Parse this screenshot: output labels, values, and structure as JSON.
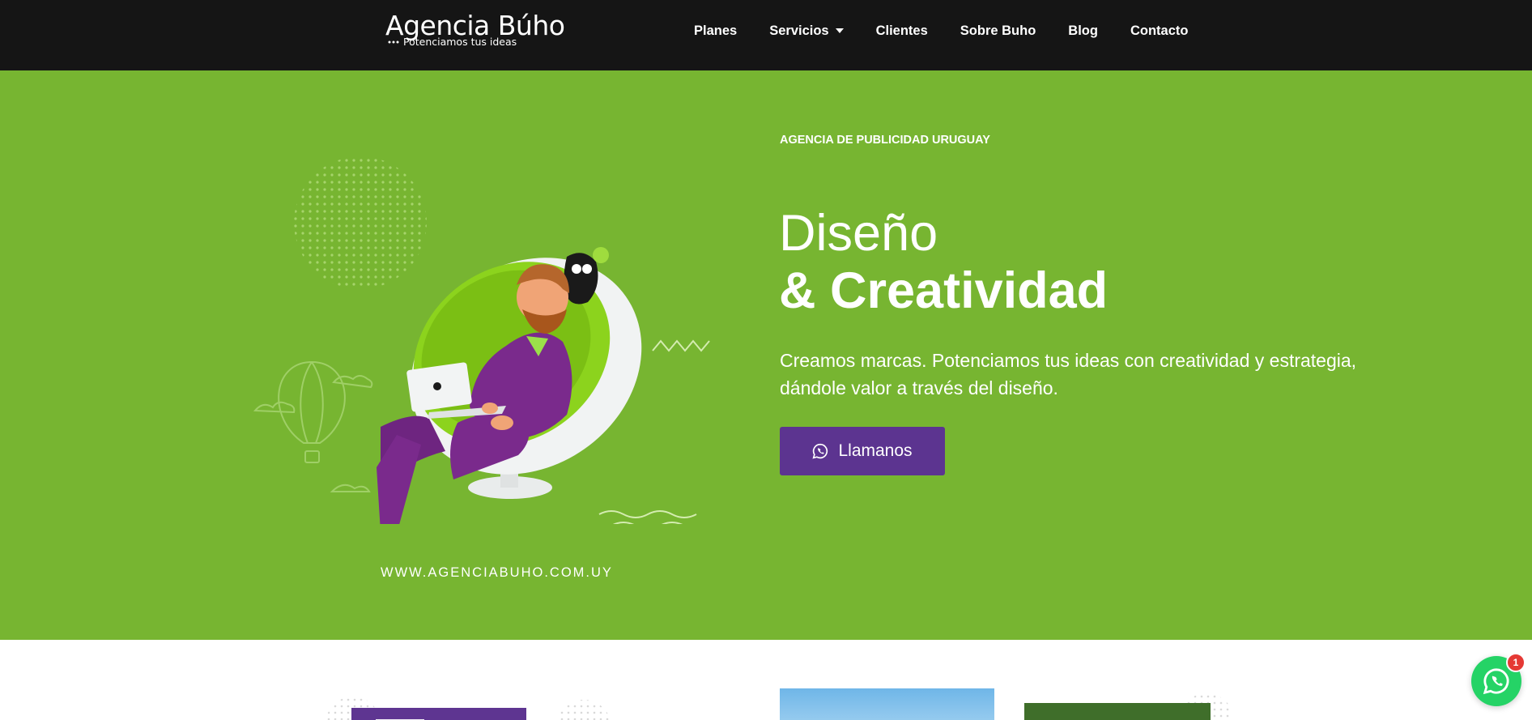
{
  "brand": {
    "name": "Agencia Búho",
    "tagline": "Potenciamos tus ideas"
  },
  "nav": {
    "items": [
      "Planes",
      "Servicios",
      "Clientes",
      "Sobre Buho",
      "Blog",
      "Contacto"
    ],
    "dropdown_item": "Servicios"
  },
  "hero": {
    "eyebrow": "AGENCIA DE PUBLICIDAD URUGUAY",
    "title_light": "Diseño",
    "title_bold": "& Creatividad",
    "description": "Creamos marcas. Potenciamos tus ideas con creatividad y estrategia, dándole valor a través del diseño.",
    "cta_label": "Llamanos",
    "illustration_caption": "WWW.AGENCIABUHO.COM.UY"
  },
  "whatsapp": {
    "badge_count": "1"
  },
  "colors": {
    "header_bg": "#151515",
    "hero_bg": "#77b531",
    "cta_bg": "#5c3490",
    "whatsapp": "#25d366",
    "badge": "#e53935"
  },
  "icons": [
    "whatsapp-icon",
    "chevron-down-icon"
  ]
}
